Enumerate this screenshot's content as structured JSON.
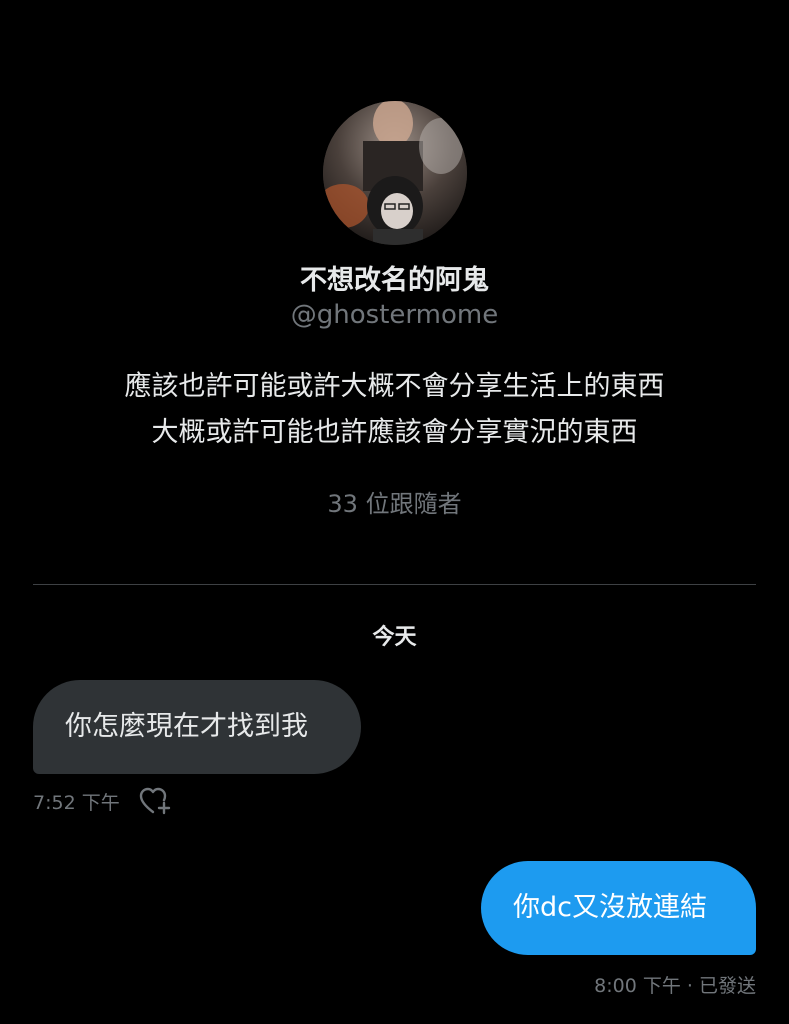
{
  "profile": {
    "avatar_icon": "profile-photo",
    "name": "不想改名的阿鬼",
    "handle": "@ghostermome",
    "bio_lines": [
      "應該也許可能或許大概不會分享生活上的東西",
      "大概或許可能也許應該會分享實況的東西"
    ],
    "followers_text": "33 位跟隨者"
  },
  "conversation": {
    "date_label": "今天",
    "messages": [
      {
        "direction": "received",
        "text": "你怎麼現在才找到我",
        "time": "7:52 下午",
        "reaction_icon": "add-reaction-heart-icon"
      },
      {
        "direction": "sent",
        "text": "你dc又沒放連結",
        "status": "8:00 下午 · 已發送"
      }
    ]
  },
  "colors": {
    "background": "#000000",
    "received_bubble": "#2f3336",
    "sent_bubble": "#1d9bf0",
    "secondary_text": "#71767b",
    "primary_text": "#e7e9ea"
  }
}
